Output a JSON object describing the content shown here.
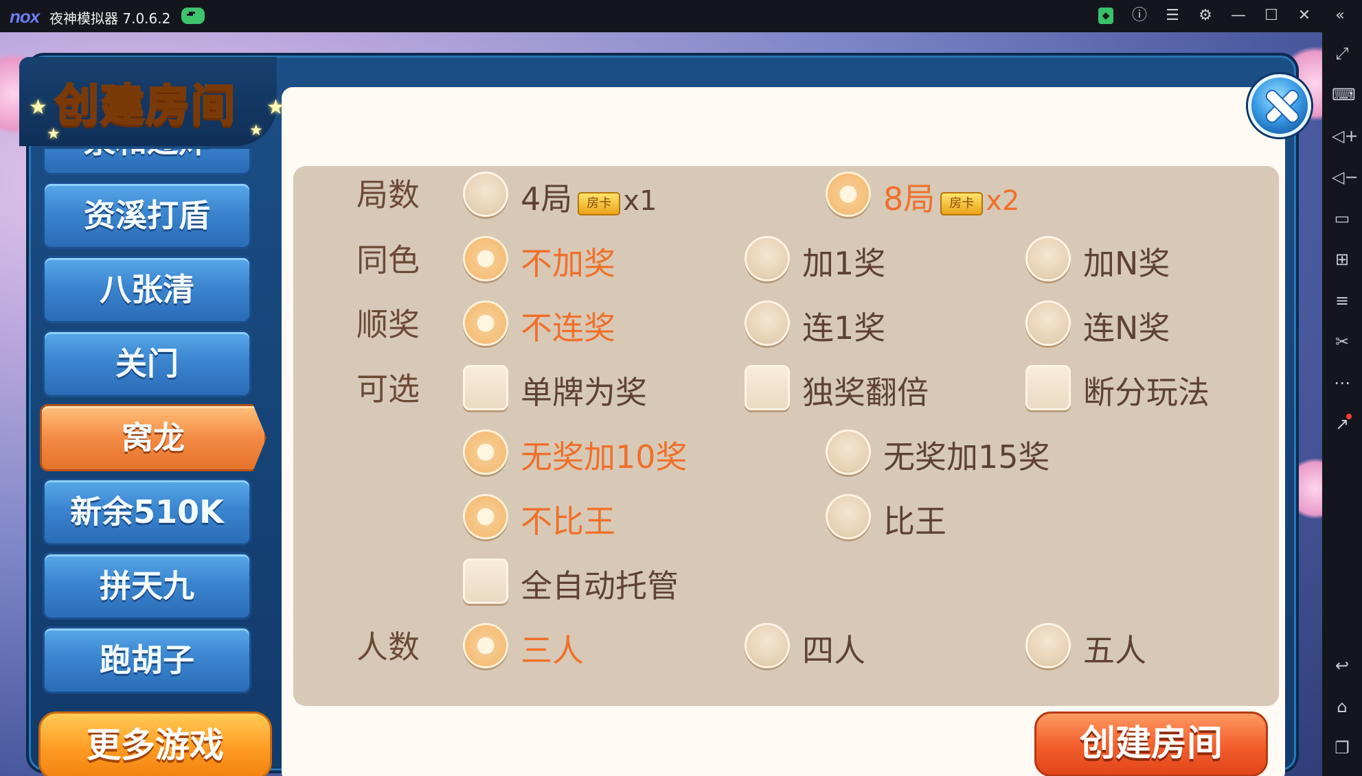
{
  "emulator": {
    "logo": "nox",
    "title": "夜神模拟器 7.0.6.2",
    "window_buttons": [
      "store-icon",
      "help-icon",
      "menu-icon",
      "settings-icon",
      "minimize-icon",
      "maximize-icon",
      "close-icon",
      "collapse-icon"
    ],
    "toolbar_icons": [
      "fullscreen-icon",
      "keyboard-icon",
      "volume-up-icon",
      "volume-down-icon",
      "screen-icon",
      "apk-install-icon",
      "multi-instance-icon",
      "scissors-icon",
      "more-icon",
      "external-icon",
      "back-icon",
      "home-icon",
      "recent-apps-icon"
    ]
  },
  "dialog": {
    "title": "创建房间",
    "games": [
      "泉和过炸",
      "资溪打盾",
      "八张清",
      "关门",
      "窝龙",
      "新余510K",
      "拼天九",
      "跑胡子"
    ],
    "active_game": "窝龙",
    "more_games_label": "更多游戏",
    "create_label": "创建房间",
    "card_icon_label": "房卡"
  },
  "options": {
    "rounds": {
      "label": "局数",
      "choices": [
        {
          "text": "4局",
          "mult": "x1",
          "selected": false
        },
        {
          "text": "8局",
          "mult": "x2",
          "selected": true
        }
      ]
    },
    "same_color": {
      "label": "同色",
      "choices": [
        {
          "text": "不加奖",
          "selected": true
        },
        {
          "text": "加1奖",
          "selected": false
        },
        {
          "text": "加N奖",
          "selected": false
        }
      ]
    },
    "sequence": {
      "label": "顺奖",
      "choices": [
        {
          "text": "不连奖",
          "selected": true
        },
        {
          "text": "连1奖",
          "selected": false
        },
        {
          "text": "连N奖",
          "selected": false
        }
      ]
    },
    "optional": {
      "label": "可选",
      "checks": [
        {
          "text": "单牌为奖",
          "checked": false
        },
        {
          "text": "独奖翻倍",
          "checked": false
        },
        {
          "text": "断分玩法",
          "checked": false
        }
      ]
    },
    "no_bonus": {
      "choices": [
        {
          "text": "无奖加10奖",
          "selected": true
        },
        {
          "text": "无奖加15奖",
          "selected": false
        }
      ]
    },
    "king": {
      "choices": [
        {
          "text": "不比王",
          "selected": true
        },
        {
          "text": "比王",
          "selected": false
        }
      ]
    },
    "auto": {
      "text": "全自动托管",
      "checked": false
    },
    "players": {
      "label": "人数",
      "choices": [
        {
          "text": "三人",
          "selected": true
        },
        {
          "text": "四人",
          "selected": false
        },
        {
          "text": "五人",
          "selected": false
        }
      ]
    }
  }
}
